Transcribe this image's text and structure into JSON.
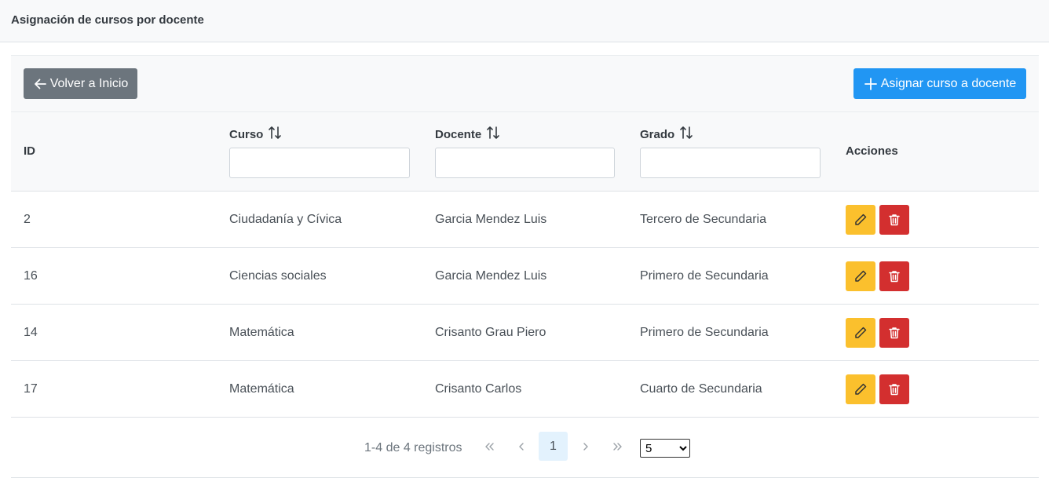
{
  "page": {
    "title": "Asignación de cursos por docente"
  },
  "toolbar": {
    "back_label": "Volver a Inicio",
    "add_label": "Asignar curso a docente"
  },
  "table": {
    "columns": {
      "id": "ID",
      "curso": "Curso",
      "docente": "Docente",
      "grado": "Grado",
      "acciones": "Acciones"
    },
    "filters": {
      "curso": "",
      "docente": "",
      "grado": ""
    },
    "rows": [
      {
        "id": "2",
        "curso": "Ciudadanía y Cívica",
        "docente": "Garcia Mendez Luis",
        "grado": "Tercero de Secundaria"
      },
      {
        "id": "16",
        "curso": "Ciencias sociales",
        "docente": "Garcia Mendez Luis",
        "grado": "Primero de Secundaria"
      },
      {
        "id": "14",
        "curso": "Matemática",
        "docente": "Crisanto Grau Piero",
        "grado": "Primero de Secundaria"
      },
      {
        "id": "17",
        "curso": "Matemática",
        "docente": "Crisanto Carlos",
        "grado": "Cuarto de Secundaria"
      }
    ]
  },
  "paginator": {
    "summary": "1-4 de 4 registros",
    "current_page": "1",
    "rows_per_page": "5",
    "first_icon": "double-chevron-left-icon",
    "prev_icon": "chevron-left-icon",
    "next_icon": "chevron-right-icon",
    "last_icon": "double-chevron-right-icon"
  },
  "icons": {
    "back": "arrow-left-icon",
    "add": "plus-icon",
    "sort": "sort-icon",
    "edit": "pencil-icon",
    "delete": "trash-icon"
  },
  "colors": {
    "back_button": "#6c757d",
    "add_button": "#2196f3",
    "edit_button": "#fbc02d",
    "delete_button": "#d32f2f",
    "active_page": "#e3f2fd"
  }
}
